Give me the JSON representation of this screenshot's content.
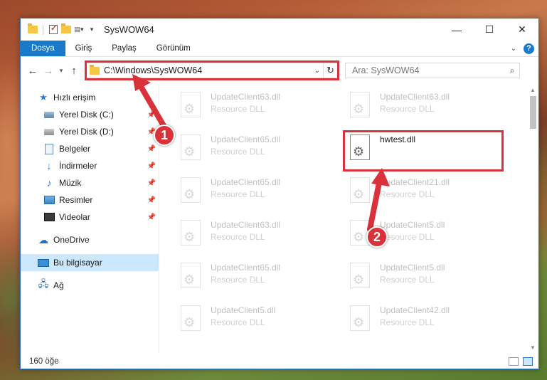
{
  "window": {
    "title": "SysWOW64",
    "controls": {
      "minimize": "—",
      "maximize": "☐",
      "close": "✕"
    }
  },
  "ribbon": {
    "tabs": [
      {
        "label": "Dosya",
        "active": true
      },
      {
        "label": "Giriş"
      },
      {
        "label": "Paylaş"
      },
      {
        "label": "Görünüm"
      }
    ],
    "help_label": "?"
  },
  "nav": {
    "address": "C:\\Windows\\SysWOW64",
    "search_placeholder": "Ara: SysWOW64"
  },
  "sidebar": {
    "items": [
      {
        "label": "Hızlı erişim",
        "icon": "star-icon"
      },
      {
        "label": "Yerel Disk (C:)",
        "icon": "disk-icon"
      },
      {
        "label": "Yerel Disk (D:)",
        "icon": "disk-icon"
      },
      {
        "label": "Belgeler",
        "icon": "document-icon"
      },
      {
        "label": "İndirmeler",
        "icon": "download-icon"
      },
      {
        "label": "Müzik",
        "icon": "music-icon"
      },
      {
        "label": "Resimler",
        "icon": "pictures-icon"
      },
      {
        "label": "Videolar",
        "icon": "videos-icon"
      },
      {
        "label": "OneDrive",
        "icon": "cloud-icon"
      },
      {
        "label": "Bu bilgisayar",
        "icon": "computer-icon",
        "selected": true
      },
      {
        "label": "Ağ",
        "icon": "network-icon"
      }
    ]
  },
  "files": {
    "left": [
      {
        "name": "UpdateClient63.dll",
        "type": "Resource DLL"
      },
      {
        "name": "UpdateClient65.dll",
        "type": "Resource DLL"
      },
      {
        "name": "UpdateClient65.dll",
        "type": "Resource DLL"
      },
      {
        "name": "UpdateClient63.dll",
        "type": "Resource DLL"
      },
      {
        "name": "UpdateClient65.dll",
        "type": "Resource DLL"
      },
      {
        "name": "UpdateClient5.dll",
        "type": "Resource DLL"
      }
    ],
    "right": [
      {
        "name": "UpdateClient63.dll",
        "type": "Resource DLL"
      },
      {
        "name": "hwtest.dll",
        "type": ""
      },
      {
        "name": "UpdateClient21.dll",
        "type": "Resource DLL"
      },
      {
        "name": "UpdateClient5.dll",
        "type": "Resource DLL"
      },
      {
        "name": "UpdateClient5.dll",
        "type": "Resource DLL"
      },
      {
        "name": "UpdateClient42.dll",
        "type": "Resource DLL"
      }
    ]
  },
  "status": {
    "count": "160 öğe"
  },
  "callouts": {
    "one": "1",
    "two": "2"
  },
  "colors": {
    "accent": "#1979ca",
    "highlight": "#d9323b",
    "selection": "#cce8ff"
  }
}
